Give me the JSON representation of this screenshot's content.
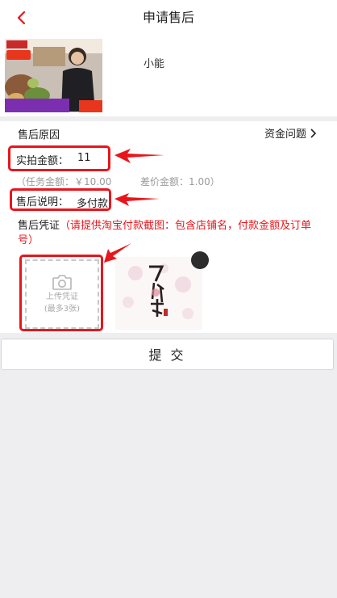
{
  "header": {
    "title": "申请售后",
    "back_icon": "chevron-left-icon",
    "accent": "#e8161c"
  },
  "product": {
    "name": "小能"
  },
  "form": {
    "reason_label": "售后原因",
    "reason_value": "资金问题",
    "amount_label": "实拍金额：",
    "amount_value": "11",
    "task_amount": "（任务金额：￥10.00",
    "diff_amount": "差价金额：1.00）",
    "note_label": "售后说明：",
    "note_value": "多付款",
    "proof_label": "售后凭证",
    "proof_hint": "（请提供淘宝付款截图：包含店铺名，付款金额及订单号）",
    "upload_label": "上传凭证",
    "upload_sub": "(最多3张)"
  },
  "submit_label": "提 交"
}
